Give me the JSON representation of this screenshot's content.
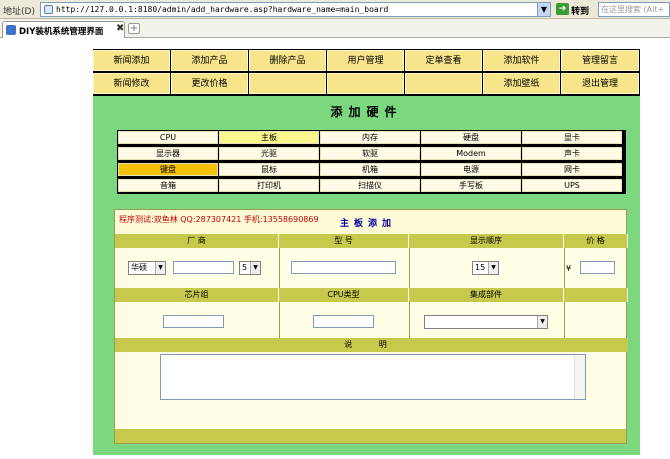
{
  "browser": {
    "address_label": "地址(D)",
    "url": "http://127.0.0.1:8180/admin/add_hardware.asp?hardware_name=main_board",
    "go_label": "转到",
    "search_placeholder": "在这里搜索 (Alt+",
    "tab_title": "DIY装机系统管理界面"
  },
  "nav": {
    "row1": [
      "新闻添加",
      "添加产品",
      "删除产品",
      "用户管理",
      "定单查看",
      "添加软件",
      "管理留言"
    ],
    "row2": [
      "新闻修改",
      "更改价格",
      "",
      "",
      "",
      "添加壁纸",
      "退出管理"
    ]
  },
  "main": {
    "title": "添加硬件",
    "categories": [
      [
        "CPU",
        "主板",
        "内存",
        "硬盘",
        "显卡"
      ],
      [
        "显示器",
        "光驱",
        "软驱",
        "Modem",
        "声卡"
      ],
      [
        "键盘",
        "鼠标",
        "机箱",
        "电源",
        "网卡"
      ],
      [
        "音箱",
        "打印机",
        "扫描仪",
        "手写板",
        "UPS"
      ]
    ],
    "selected_category": "主板",
    "highlighted_category": "键盘"
  },
  "form": {
    "test_info": "程序测试:双鱼林 QQ:287307421 手机:13558690869",
    "heading": "主板添加",
    "headers_row1": [
      "厂 商",
      "型 号",
      "显示顺序",
      "价 格"
    ],
    "headers_row2": [
      "芯片组",
      "CPU类型",
      "集成部件",
      ""
    ],
    "desc_header": "说 明",
    "manufacturer_select": "华硕",
    "manufacturer_sub_select": "5",
    "order_select": "15",
    "price_prefix": "¥",
    "integrated_select": ""
  },
  "colors": {
    "nav_bg": "#f7e58b",
    "panel_bg": "#7bd87e",
    "header_bar": "#c6c94c",
    "selected": "#f5c200",
    "red_text": "#c00000",
    "blue_text": "#0000a0"
  }
}
